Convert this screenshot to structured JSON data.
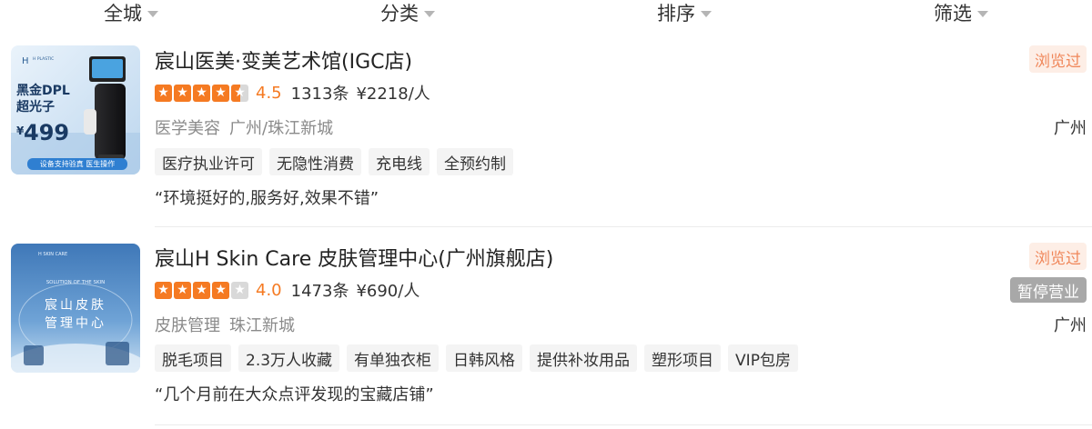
{
  "filters": [
    {
      "label": "全城"
    },
    {
      "label": "分类"
    },
    {
      "label": "排序"
    },
    {
      "label": "筛选"
    }
  ],
  "shops": [
    {
      "title": "宸山医美·变美艺术馆(IGC店)",
      "rating": 4.5,
      "score": "4.5",
      "reviews": "1313条",
      "price": "¥2218/人",
      "category": "医学美容",
      "area": "广州/珠江新城",
      "city": "广州",
      "viewed": "浏览过",
      "tags": [
        "医疗执业许可",
        "无隐性消费",
        "充电线",
        "全预约制"
      ],
      "quote": "“环境挺好的,服务好,效果不错”",
      "thumb": {
        "brand": "H PLASTIC",
        "headline_1": "黑金DPL",
        "headline_2": "超光子",
        "price": "499",
        "footer": "设备支持验真 医生操作"
      }
    },
    {
      "title": "宸山H Skin Care 皮肤管理中心(广州旗舰店)",
      "rating": 4.0,
      "score": "4.0",
      "reviews": "1473条",
      "price": "¥690/人",
      "category": "皮肤管理",
      "area": "珠江新城",
      "city": "广州",
      "viewed": "浏览过",
      "status": "暂停营业",
      "tags": [
        "脱毛项目",
        "2.3万人收藏",
        "有单独衣柜",
        "日韩风格",
        "提供补妆用品",
        "塑形项目",
        "VIP包房"
      ],
      "quote": "“几个月前在大众点评发现的宝藏店铺”",
      "thumb": {
        "brand": "H SKIN CARE",
        "subtitle": "SOLUTION OF THE SKIN",
        "headline_1": "宸山皮肤",
        "headline_2": "管理中心"
      }
    }
  ],
  "colors": {
    "accent": "#f57a22",
    "viewed_bg": "#fdeee6",
    "viewed_text": "#f0875a",
    "status_bg": "#a8a8a8",
    "tag_bg": "#f4f4f4"
  }
}
